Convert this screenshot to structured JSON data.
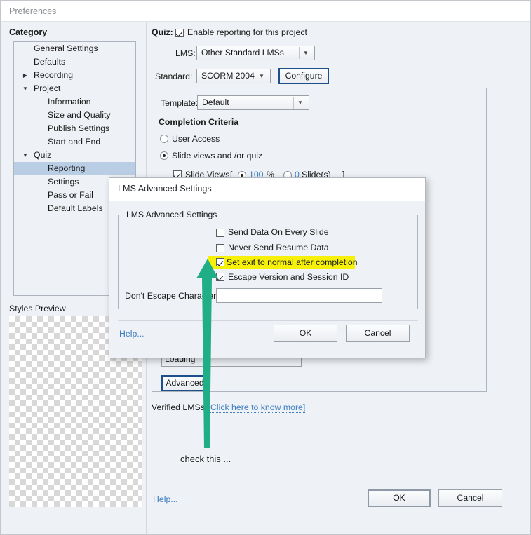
{
  "window": {
    "title": "Preferences"
  },
  "sidebar": {
    "header": "Category",
    "items": [
      {
        "label": "General Settings",
        "level": 1,
        "twisty": "",
        "selected": false
      },
      {
        "label": "Defaults",
        "level": 1,
        "twisty": "",
        "selected": false
      },
      {
        "label": "Recording",
        "level": 1,
        "twisty": "▶",
        "selected": false
      },
      {
        "label": "Project",
        "level": 1,
        "twisty": "▼",
        "selected": false
      },
      {
        "label": "Information",
        "level": 2,
        "twisty": "",
        "selected": false
      },
      {
        "label": "Size and Quality",
        "level": 2,
        "twisty": "",
        "selected": false
      },
      {
        "label": "Publish Settings",
        "level": 2,
        "twisty": "",
        "selected": false
      },
      {
        "label": "Start and End",
        "level": 2,
        "twisty": "",
        "selected": false
      },
      {
        "label": "Quiz",
        "level": 1,
        "twisty": "▼",
        "selected": false
      },
      {
        "label": "Reporting",
        "level": 2,
        "twisty": "",
        "selected": true
      },
      {
        "label": "Settings",
        "level": 2,
        "twisty": "",
        "selected": false
      },
      {
        "label": "Pass or Fail",
        "level": 2,
        "twisty": "",
        "selected": false
      },
      {
        "label": "Default Labels",
        "level": 2,
        "twisty": "",
        "selected": false
      }
    ],
    "styles_preview_label": "Styles Preview"
  },
  "main": {
    "quiz_label": "Quiz:",
    "enable_reporting_label": "Enable reporting for this project",
    "enable_reporting_checked": true,
    "lms_label": "LMS:",
    "lms_value": "Other Standard LMSs",
    "standard_label": "Standard:",
    "standard_value": "SCORM 2004",
    "configure_button": "Configure",
    "template_label": "Template:",
    "template_value": "Default",
    "completion_criteria_title": "Completion Criteria",
    "user_access_label": "User Access",
    "user_access_selected": false,
    "slide_views_quiz_label": "Slide views and /or quiz",
    "slide_views_quiz_selected": true,
    "slide_views_label": "Slide Views",
    "slide_views_checked": true,
    "bracket_open": "[",
    "percent_value": "100",
    "percent_unit": "%",
    "percent_selected": true,
    "slides_value": "0",
    "slides_unit": "Slide(s)",
    "slides_selected": false,
    "bracket_close": "]",
    "loading_value": "Loading",
    "advanced_button": "Advanced",
    "verified_lms_label": "Verified LMSs:",
    "verified_lms_link": "Click here to know more]",
    "help_link": "Help...",
    "ok_button": "OK",
    "cancel_button": "Cancel"
  },
  "dialog": {
    "title": "LMS Advanced Settings",
    "group_legend": "LMS Advanced Settings",
    "checkboxes": [
      {
        "label": "Send Data On Every Slide",
        "checked": false,
        "highlighted": false
      },
      {
        "label": "Never Send Resume Data",
        "checked": false,
        "highlighted": false
      },
      {
        "label": "Set exit to normal after completion",
        "checked": true,
        "highlighted": true
      },
      {
        "label": "Escape Version and Session ID",
        "checked": true,
        "highlighted": false
      }
    ],
    "dont_escape_label": "Don't Escape Characters:",
    "dont_escape_value": "",
    "help_link": "Help...",
    "ok_button": "OK",
    "cancel_button": "Cancel"
  },
  "annotation": {
    "text": "check this ...",
    "arrow_color": "#1fae85"
  },
  "colors": {
    "background": "#eef1f5",
    "selection": "#b9cde4",
    "link": "#3c7ec2",
    "highlight": "#f7f10a",
    "focus_border": "#1f4e8c"
  }
}
